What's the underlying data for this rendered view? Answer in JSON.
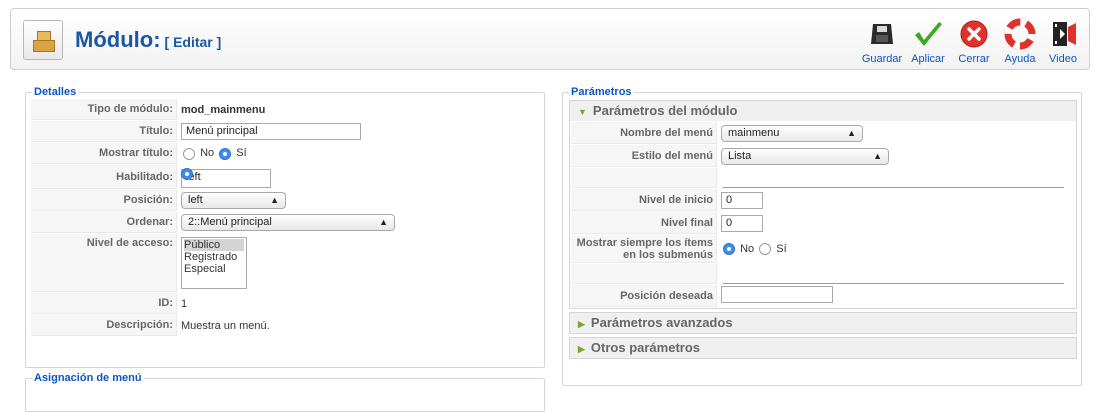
{
  "header": {
    "title": "Módulo:",
    "subtitle": "[ Editar ]",
    "toolbar": [
      {
        "label": "Guardar",
        "icon": "save-icon"
      },
      {
        "label": "Aplicar",
        "icon": "apply-icon"
      },
      {
        "label": "Cerrar",
        "icon": "close-icon"
      },
      {
        "label": "Ayuda",
        "icon": "help-icon"
      },
      {
        "label": "Video",
        "icon": "video-icon"
      }
    ]
  },
  "details": {
    "legend": "Detalles",
    "rows": {
      "tipo": {
        "label": "Tipo de módulo:",
        "value": "mod_mainmenu"
      },
      "titulo": {
        "label": "Título:",
        "value": "Menú principal"
      },
      "mostrar": {
        "label": "Mostrar título:",
        "no": "No",
        "si": "Sí"
      },
      "habilitado": {
        "label": "Habilitado:",
        "value": "left"
      },
      "posicion": {
        "label": "Posición:",
        "value": "left"
      },
      "ordenar": {
        "label": "Ordenar:",
        "value": "2::Menú principal"
      },
      "nivel": {
        "label": "Nivel de acceso:",
        "options": [
          "Público",
          "Registrado",
          "Especial"
        ]
      },
      "id": {
        "label": "ID:",
        "value": "1"
      },
      "descripcion": {
        "label": "Descripción:",
        "value": "Muestra un menú."
      }
    }
  },
  "menu_assign": {
    "legend": "Asignación de menú"
  },
  "params": {
    "legend": "Parámetros",
    "module_pane": {
      "title": "Parámetros del módulo",
      "nombre": {
        "label": "Nombre del menú",
        "value": "mainmenu"
      },
      "estilo": {
        "label": "Estilo del menú",
        "value": "Lista"
      },
      "inicio": {
        "label": "Nivel de inicio",
        "value": "0"
      },
      "final": {
        "label": "Nivel final",
        "value": "0"
      },
      "mostrar": {
        "label": "Mostrar siempre los ítems en los submenús",
        "no": "No",
        "si": "Sí"
      },
      "posicion": {
        "label": "Posición deseada",
        "value": ""
      }
    },
    "advanced_pane": {
      "title": "Parámetros avanzados"
    },
    "other_pane": {
      "title": "Otros parámetros"
    }
  },
  "colors": {
    "accent": "#0b55c4",
    "title": "#1b57a6",
    "apply": "#3ca828",
    "close": "#e0312a"
  }
}
